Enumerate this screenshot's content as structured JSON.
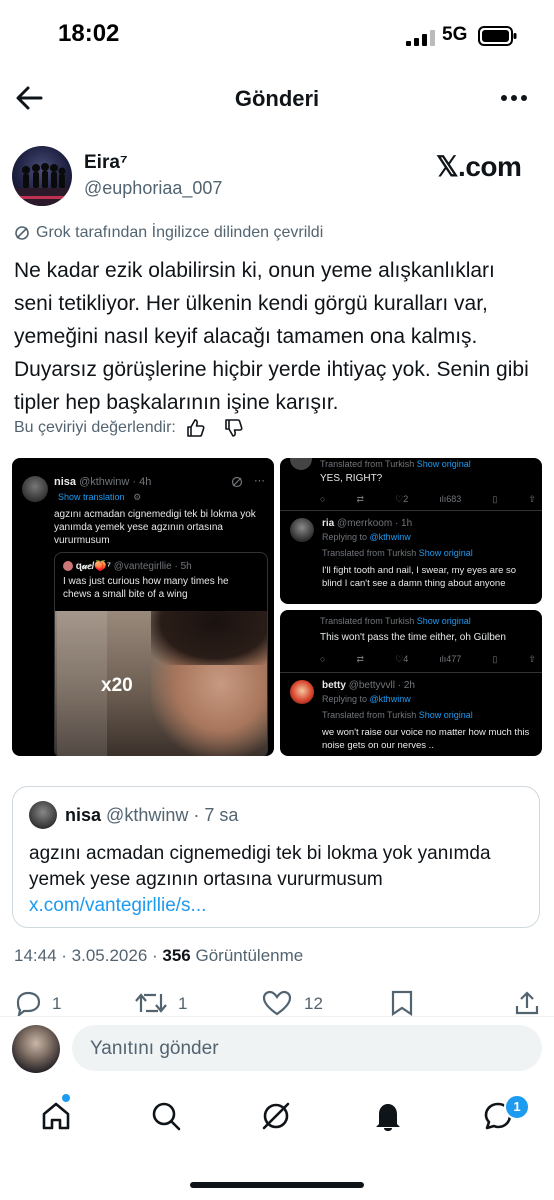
{
  "status_bar": {
    "time": "18:02",
    "network": "5G"
  },
  "topbar": {
    "title": "Gönderi"
  },
  "author": {
    "name": "Eira⁷",
    "handle": "@euphoriaa_007"
  },
  "brand": {
    "xcom": "𝕏.com"
  },
  "translation": {
    "notice": "Grok tarafından İngilizce dilinden çevrildi",
    "rate_prompt": "Bu çeviriyi değerlendir:"
  },
  "post_text": "Ne kadar ezik olabilirsin ki, onun yeme alışkanlıkları seni tetikliyor. Her ülkenin kendi görgü kuralları var, yemeğini nasıl keyif alacağı tamamen ona kalmış. Duyarsız görüşlerine hiçbir yerde ihtiyaç yok. Senin gibi tipler hep başkalarının işine karışır.",
  "media": {
    "left": {
      "name": "nisa",
      "handle": "@kthwinw · 4h",
      "show_translation": "Show translation",
      "text": "agzını acmadan cignemedigi tek bi lokma yok yanımda yemek yese agzının ortasına vururmusum",
      "quote_name": "ɋ𝓊𝑒/🍑⁷",
      "quote_handle": "@vantegirllie · 5h",
      "quote_text": "I was just curious how many times he chews a small bite of a wing",
      "overlay": "x20"
    },
    "top_right": {
      "translated": "Translated from Turkish",
      "show_original": "Show original",
      "text": "YES, RIGHT?",
      "likes": "2",
      "views": "683",
      "name": "ria",
      "handle": "@merrkoom · 1h",
      "replying": "Replying to",
      "replying_to": "@kthwinw",
      "translated2": "Translated from Turkish",
      "show_original2": "Show original",
      "text2": "I'll fight tooth and nail, I swear, my eyes are so blind I can't see a damn thing about anyone"
    },
    "bottom_right": {
      "translated": "Translated from Turkish",
      "show_original": "Show original",
      "text": "This won't pass the time either, oh Gülben",
      "likes": "4",
      "views": "477",
      "name": "betty",
      "handle": "@bettyvvll · 2h",
      "replying": "Replying to",
      "replying_to": "@kthwinw",
      "translated2": "Translated from Turkish",
      "show_original2": "Show original",
      "text2": "we won't raise our voice no matter how much this noise gets on our nerves .."
    }
  },
  "quote": {
    "name": "nisa",
    "handle": "@kthwinw · 7 sa",
    "text": "agzını acmadan cignemedigi tek bi lokma yok yanımda yemek yese agzının ortasına vururmusum ",
    "link": "x.com/vantegirllie/s..."
  },
  "meta": {
    "time_date": "14:44 · 3.05.2026 · ",
    "views": "356",
    "views_label": " Görüntülenme"
  },
  "actions": {
    "replies": "1",
    "reposts": "1",
    "likes": "12"
  },
  "reply_bar": {
    "placeholder": "Yanıtını gönder"
  },
  "bottom_nav": {
    "messages_badge": "1"
  },
  "colors": {
    "accent": "#1d9bf0",
    "text": "#0f1419",
    "muted": "#536471"
  }
}
